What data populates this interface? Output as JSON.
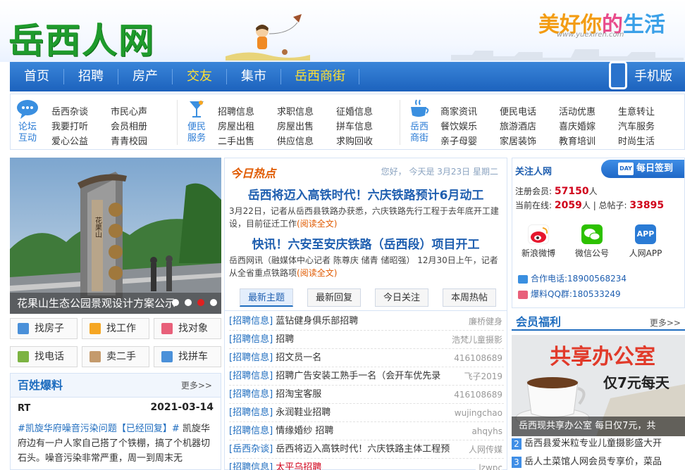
{
  "header": {
    "logo": "岳西人网",
    "slogan_1": "美好你",
    "slogan_2": "的",
    "slogan_3": "生活",
    "slogan_url": "www.yuexiren.com"
  },
  "nav": {
    "items": [
      {
        "label": "首页"
      },
      {
        "label": "招聘"
      },
      {
        "label": "房产"
      },
      {
        "label": "交友",
        "active": true
      },
      {
        "label": "集市"
      },
      {
        "label": "岳西商街"
      }
    ],
    "mobile": "手机版"
  },
  "catbar": {
    "forum": {
      "icon_label_1": "论坛",
      "icon_label_2": "互动",
      "links": [
        "岳西杂谈",
        "市民心声",
        "我要打听",
        "会员相册",
        "爱心公益",
        "青青校园"
      ]
    },
    "service": {
      "icon_label_1": "便民",
      "icon_label_2": "服务",
      "links": [
        "招聘信息",
        "求职信息",
        "征婚信息",
        "房屋出租",
        "房屋出售",
        "拼车信息",
        "二手出售",
        "供应信息",
        "求购回收"
      ]
    },
    "street": {
      "icon_label_1": "岳西",
      "icon_label_2": "商街",
      "links": [
        "商家资讯",
        "便民电话",
        "活动优惠",
        "生意转让",
        "餐饮娱乐",
        "旅游酒店",
        "喜庆婚嫁",
        "汽车服务",
        "亲子母婴",
        "家居装饰",
        "教育培训",
        "时尚生活"
      ]
    }
  },
  "slider": {
    "caption": "花果山生态公园景观设计方案公示",
    "sign_text": "花果山"
  },
  "quick": [
    {
      "label": "找房子",
      "icon": "house-icon",
      "color": "#4a90d9"
    },
    {
      "label": "找工作",
      "icon": "job-icon",
      "color": "#f5a623"
    },
    {
      "label": "找对象",
      "icon": "heart-icon",
      "color": "#e8607a"
    },
    {
      "label": "找电话",
      "icon": "phone-icon",
      "color": "#7cb342"
    },
    {
      "label": "卖二手",
      "icon": "bag-icon",
      "color": "#c49a6c"
    },
    {
      "label": "找拼车",
      "icon": "car-icon",
      "color": "#4a90d9"
    }
  ],
  "baoliao": {
    "title": "百姓爆料",
    "more": "更多>>",
    "user": "RT",
    "date": "2021-03-14",
    "tag": "#凯旋华府噪音污染问题【已经回复】#",
    "text": " 凯旋华府边有一户人家自己搭了个铁棚，搞了个机器切石头。噪音污染非常严重，周一到周末无"
  },
  "hot": {
    "title": "今日热点",
    "greeting": "您好， 今天是 3月23日 星期二",
    "headline_1": "岳西将迈入高铁时代！六庆铁路预计6月动工",
    "summary_1": "3月22日，记者从岳西县铁路办获悉，六庆铁路先行工程于去年底开工建设，目前征迁工作",
    "read_1": "(阅读全文)",
    "headline_2": "快讯！六安至安庆铁路（岳西段）项目开工",
    "summary_2": "岳西网讯（融媒体中心记者 陈尊庆 储青 储昭强） 12月30日上午，记者从全省重点铁路项",
    "read_2": "(阅读全文)"
  },
  "tabs": [
    "最新主题",
    "最新回复",
    "今日关注",
    "本周热帖"
  ],
  "topics": [
    {
      "cat": "[招聘信息]",
      "title": "蓝钻健身俱乐部招聘",
      "author": "廉桥健身"
    },
    {
      "cat": "[招聘信息]",
      "title": "招聘",
      "author": "浩梵儿童摄影"
    },
    {
      "cat": "[招聘信息]",
      "title": "招文员一名",
      "author": "416108689"
    },
    {
      "cat": "[招聘信息]",
      "title": "招聘广告安装工熟手一名（会开车优先录",
      "author": "飞子2019"
    },
    {
      "cat": "[招聘信息]",
      "title": "招淘宝客服",
      "author": "416108689"
    },
    {
      "cat": "[招聘信息]",
      "title": "永润鞋业招聘",
      "author": "wujingchao"
    },
    {
      "cat": "[招聘信息]",
      "title": "情缘婚纱 招聘",
      "author": "ahqyhs"
    },
    {
      "cat": "[岳西杂谈]",
      "title": "岳西将迈入高铁时代！六庆铁路主体工程预",
      "author": "人网传媒"
    },
    {
      "cat": "[招聘信息]",
      "title": "太平乌招聘",
      "author": "lzwpc",
      "red": true
    }
  ],
  "follow": {
    "title": "关注人网",
    "signin": "每日签到",
    "signin_day": "DAY",
    "members_label": "注册会员:",
    "members": "57150",
    "members_unit": "人",
    "online_label": "当前在线:",
    "online": "2059",
    "online_unit": "人",
    "posts_label": "| 总帖子:",
    "posts": "33895",
    "social": [
      {
        "label": "新浪微博",
        "icon": "weibo-icon",
        "color": "#e6162d"
      },
      {
        "label": "微信公号",
        "icon": "wechat-icon",
        "color": "#2dc100"
      },
      {
        "label": "人网APP",
        "icon": "app-icon",
        "color": "#2a7bd5",
        "text": "APP"
      }
    ],
    "phone": "合作电话:18900568234",
    "qq": "爆料QQ群:180533249"
  },
  "welfare": {
    "title": "会员福利",
    "more": "更多>>",
    "ad_h1": "共享办公室",
    "ad_h2": "仅7元每天",
    "ad_caption": "岳西现共享办公室 每日仅7元，共",
    "items": [
      {
        "num": "2",
        "text": "岳西县爱米粒专业儿童摄影盛大开"
      },
      {
        "num": "3",
        "text": "岳人土菜馆人网会员专享价，菜品"
      }
    ]
  }
}
